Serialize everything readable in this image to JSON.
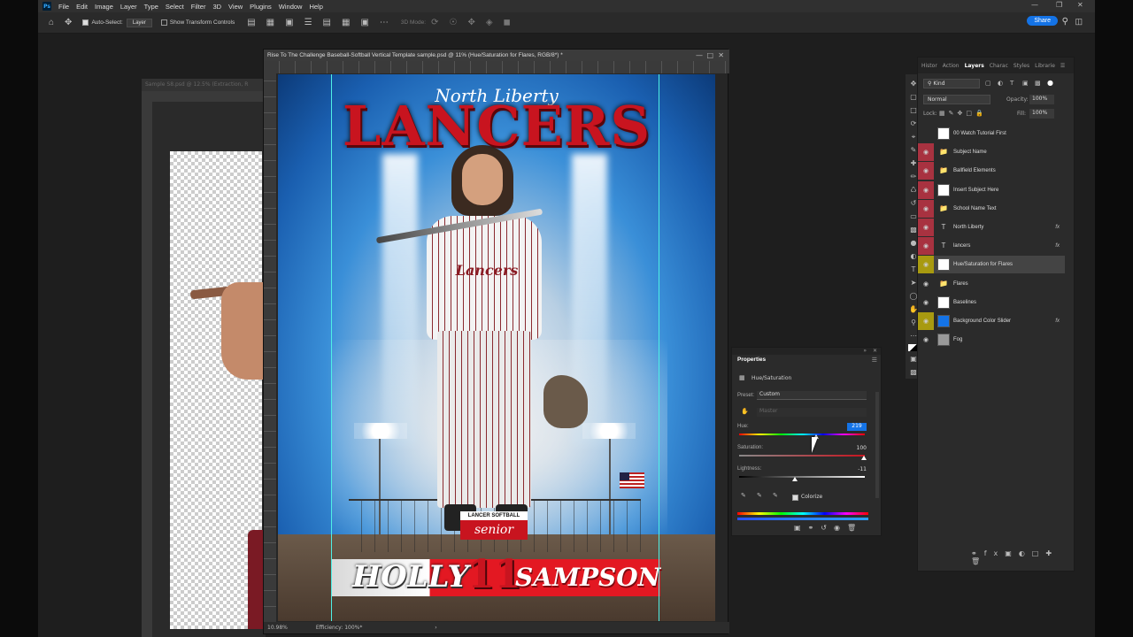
{
  "menu": {
    "logo": "Ps",
    "items": [
      "File",
      "Edit",
      "Image",
      "Layer",
      "Type",
      "Select",
      "Filter",
      "3D",
      "View",
      "Plugins",
      "Window",
      "Help"
    ]
  },
  "options": {
    "auto_select_label": "Auto-Select:",
    "auto_select_target": "Layer",
    "transform_label": "Show Transform Controls",
    "mode_3d": "3D Mode:",
    "share_label": "Share"
  },
  "doc_back": {
    "title": "Sample S8.psd @ 12.5% (Extraction, R"
  },
  "doc_main": {
    "title": "Rise To The Challenge Baseball-Softball Vertical Template sample.psd @ 11% (Hue/Saturation for Flares, RGB/8*) *",
    "zoom": "10.98%",
    "efficiency": "Efficiency: 100%*",
    "poster": {
      "script_title": "North Liberty",
      "team": "LANCERS",
      "jersey": "Lancers",
      "badge_top": "LANCER SOFTBALL",
      "badge_mid": "senior",
      "first_name": "HOLLY",
      "number": "11",
      "last_name": "SAMPSON"
    }
  },
  "layers_panel": {
    "tabs": [
      "Histor",
      "Action",
      "Layers",
      "Charac",
      "Styles",
      "Librarie"
    ],
    "active_tab": "Layers",
    "filter": "Kind",
    "blend_mode": "Normal",
    "opacity_label": "Opacity:",
    "opacity": "100%",
    "lock_label": "Lock:",
    "fill_label": "Fill:",
    "fill": "100%",
    "layers": [
      {
        "name": "00 Watch Tutorial First",
        "color": "",
        "visible": false,
        "fx": false
      },
      {
        "name": "Subject Name",
        "color": "#a83240",
        "visible": true,
        "fx": false
      },
      {
        "name": "Ballfield Elements",
        "color": "#a83240",
        "visible": true,
        "fx": false
      },
      {
        "name": "Insert Subject Here",
        "color": "#a83240",
        "visible": true,
        "fx": false
      },
      {
        "name": "School Name Text",
        "color": "#a83240",
        "visible": true,
        "fx": false
      },
      {
        "name": "North Liberty",
        "color": "#a83240",
        "visible": true,
        "fx": true
      },
      {
        "name": "lancers",
        "color": "#a83240",
        "visible": true,
        "fx": true
      },
      {
        "name": "Hue/Saturation for Flares",
        "color": "#a89a10",
        "visible": true,
        "fx": false
      },
      {
        "name": "Flares",
        "color": "",
        "visible": true,
        "fx": false
      },
      {
        "name": "Baselines",
        "color": "",
        "visible": true,
        "fx": false
      },
      {
        "name": "Background Color Slider",
        "color": "#a89a10",
        "visible": true,
        "fx": true
      },
      {
        "name": "Fog",
        "color": "",
        "visible": true,
        "fx": false
      }
    ],
    "fx_label": "fx"
  },
  "properties": {
    "title": "Properties",
    "subtitle": "Hue/Saturation",
    "preset_label": "Preset:",
    "preset_value": "Custom",
    "channel_value": "Master",
    "hue_label": "Hue:",
    "hue_value": "219",
    "sat_label": "Saturation:",
    "sat_value": "100",
    "light_label": "Lightness:",
    "light_value": "-11",
    "colorize_label": "Colorize"
  },
  "colors": {
    "accent": "#1473e6",
    "red_label": "#a83240",
    "yellow_label": "#a89a10"
  }
}
